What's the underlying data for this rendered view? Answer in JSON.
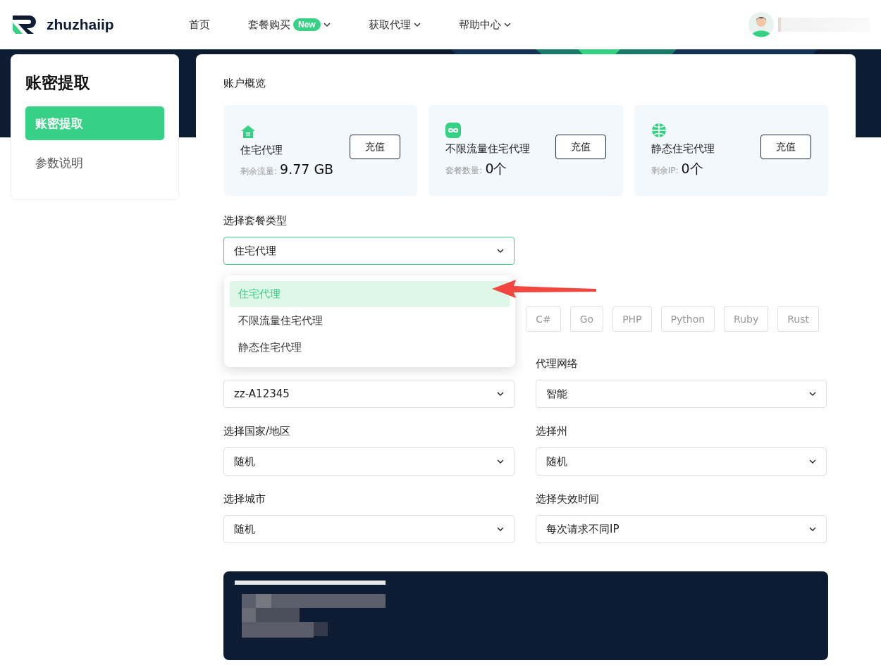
{
  "header": {
    "logo": "zhuzhaiip",
    "nav": [
      {
        "label": "首页",
        "caret": false
      },
      {
        "label": "套餐购买",
        "badge": "New",
        "caret": true
      },
      {
        "label": "获取代理",
        "caret": true
      },
      {
        "label": "帮助中心",
        "caret": true
      }
    ]
  },
  "sidebar": {
    "title": "账密提取",
    "items": [
      {
        "label": "账密提取",
        "selected": true
      },
      {
        "label": "参数说明",
        "selected": false
      }
    ]
  },
  "overview": {
    "title": "账户概览",
    "cards": [
      {
        "kind": "house",
        "name": "住宅代理",
        "button": "充值",
        "stat_label": "剩余流量:",
        "stat_value": "9.77 GB"
      },
      {
        "kind": "infinity",
        "name": "不限流量住宅代理",
        "button": "充值",
        "stat_label": "套餐数量:",
        "stat_value": "0个"
      },
      {
        "kind": "globe",
        "name": "静态住宅代理",
        "button": "充值",
        "stat_label": "剩余IP:",
        "stat_value": "0个"
      }
    ]
  },
  "plan_select": {
    "label": "选择套餐类型",
    "value": "住宅代理",
    "expanded": true,
    "options": [
      {
        "label": "住宅代理",
        "selected": true
      },
      {
        "label": "不限流量住宅代理",
        "selected": false
      },
      {
        "label": "静态住宅代理",
        "selected": false
      }
    ]
  },
  "languages": [
    "C#",
    "Go",
    "PHP",
    "Python",
    "Ruby",
    "Rust"
  ],
  "fields": [
    {
      "value": "zz-A12345"
    },
    {
      "label": "代理网络",
      "value": "智能"
    },
    {
      "label": "选择国家/地区",
      "value": "随机"
    },
    {
      "label": "选择州",
      "value": "随机"
    },
    {
      "label": "选择城市",
      "value": "随机"
    },
    {
      "label": "选择失效时间",
      "value": "每次请求不同IP"
    }
  ]
}
